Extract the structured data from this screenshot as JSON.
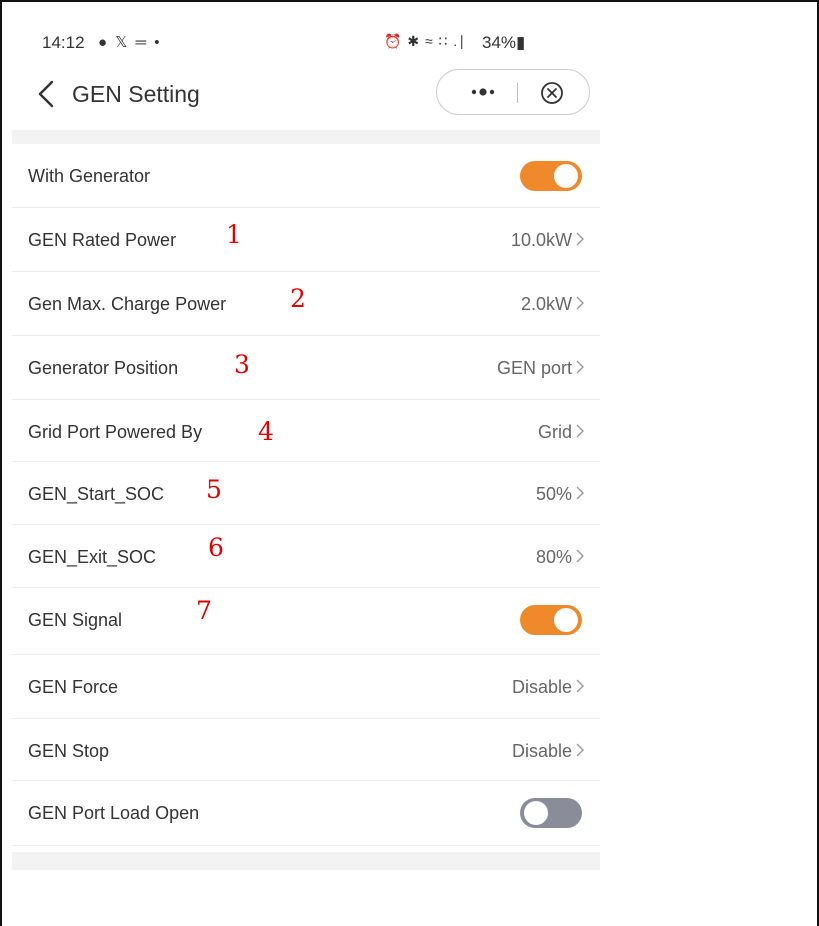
{
  "status_bar": {
    "time": "14:12",
    "left_icons": "● 𝕏 ═ •",
    "right_icons": "⏰ ✱ ≈ ∷ .∣",
    "battery": "34%"
  },
  "header": {
    "title": "GEN Setting"
  },
  "settings": [
    {
      "label": "With Generator",
      "type": "toggle",
      "on": true,
      "marker": ""
    },
    {
      "label": "GEN Rated Power",
      "type": "value",
      "value": "10.0kW",
      "marker": "1"
    },
    {
      "label": "Gen Max. Charge Power",
      "type": "value",
      "value": "2.0kW",
      "marker": "2"
    },
    {
      "label": "Generator Position",
      "type": "value",
      "value": "GEN port",
      "marker": "3"
    },
    {
      "label": "Grid Port Powered By",
      "type": "value",
      "value": "Grid",
      "marker": "4"
    },
    {
      "label": "GEN_Start_SOC",
      "type": "value",
      "value": "50%",
      "marker": "5"
    },
    {
      "label": "GEN_Exit_SOC",
      "type": "value",
      "value": "80%",
      "marker": "6"
    },
    {
      "label": "GEN Signal",
      "type": "toggle",
      "on": true,
      "marker": "7"
    },
    {
      "label": "GEN Force",
      "type": "value",
      "value": "Disable",
      "marker": ""
    },
    {
      "label": "GEN Stop",
      "type": "value",
      "value": "Disable",
      "marker": ""
    },
    {
      "label": "GEN Port Load Open",
      "type": "toggle",
      "on": false,
      "marker": ""
    }
  ],
  "colors": {
    "toggle_on": "#ee8a2c",
    "toggle_off": "#8a8c99",
    "annotation": "#e60000"
  }
}
